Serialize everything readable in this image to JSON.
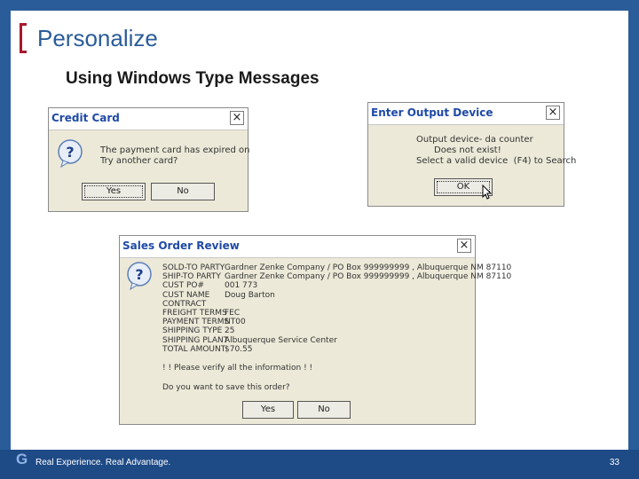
{
  "slide": {
    "title": "Personalize",
    "subtitle": "Using Windows Type Messages"
  },
  "dialog_credit": {
    "title": "Credit Card",
    "message": "The payment card has expired on\nTry another card?",
    "yes": "Yes",
    "no": "No"
  },
  "dialog_output": {
    "title": "Enter Output Device",
    "message_lines": [
      "Output device- da counter",
      "Does not exist!",
      "Select a valid device  (F4) to Search"
    ],
    "ok": "OK"
  },
  "dialog_sales": {
    "title": "Sales Order Review",
    "rows": [
      {
        "label": "SOLD-TO PARTY",
        "value": "Gardner Zenke Company / PO Box 999999999 , Albuquerque NM 87110"
      },
      {
        "label": "SHIP-TO PARTY",
        "value": "Gardner Zenke Company / PO Box 999999999 , Albuquerque NM 87110"
      },
      {
        "label": "CUST PO#",
        "value": "001 773"
      },
      {
        "label": "CUST NAME",
        "value": "Doug Barton"
      },
      {
        "label": "CONTRACT",
        "value": ""
      },
      {
        "label": "FREIGHT TERMS",
        "value": "FEC"
      },
      {
        "label": "PAYMENT TERMS",
        "value": "NT00"
      },
      {
        "label": "SHIPPING TYPE",
        "value": "25"
      },
      {
        "label": "SHIPPING PLANT",
        "value": "Albuquerque Service Center"
      },
      {
        "label": "TOTAL AMOUNT",
        "value": "$70.55"
      }
    ],
    "warning": "! ! Please verify all the information ! !",
    "question": "Do you want to save this order?",
    "yes": "Yes",
    "no": "No"
  },
  "footer": {
    "logo": "G",
    "tagline": "Real Experience. Real Advantage.",
    "page": "33"
  },
  "colors": {
    "frame": "#2a5c99",
    "bracket": "#a6192e",
    "dialog_bg": "#ece9d8",
    "title_text": "#1f4aa6"
  }
}
